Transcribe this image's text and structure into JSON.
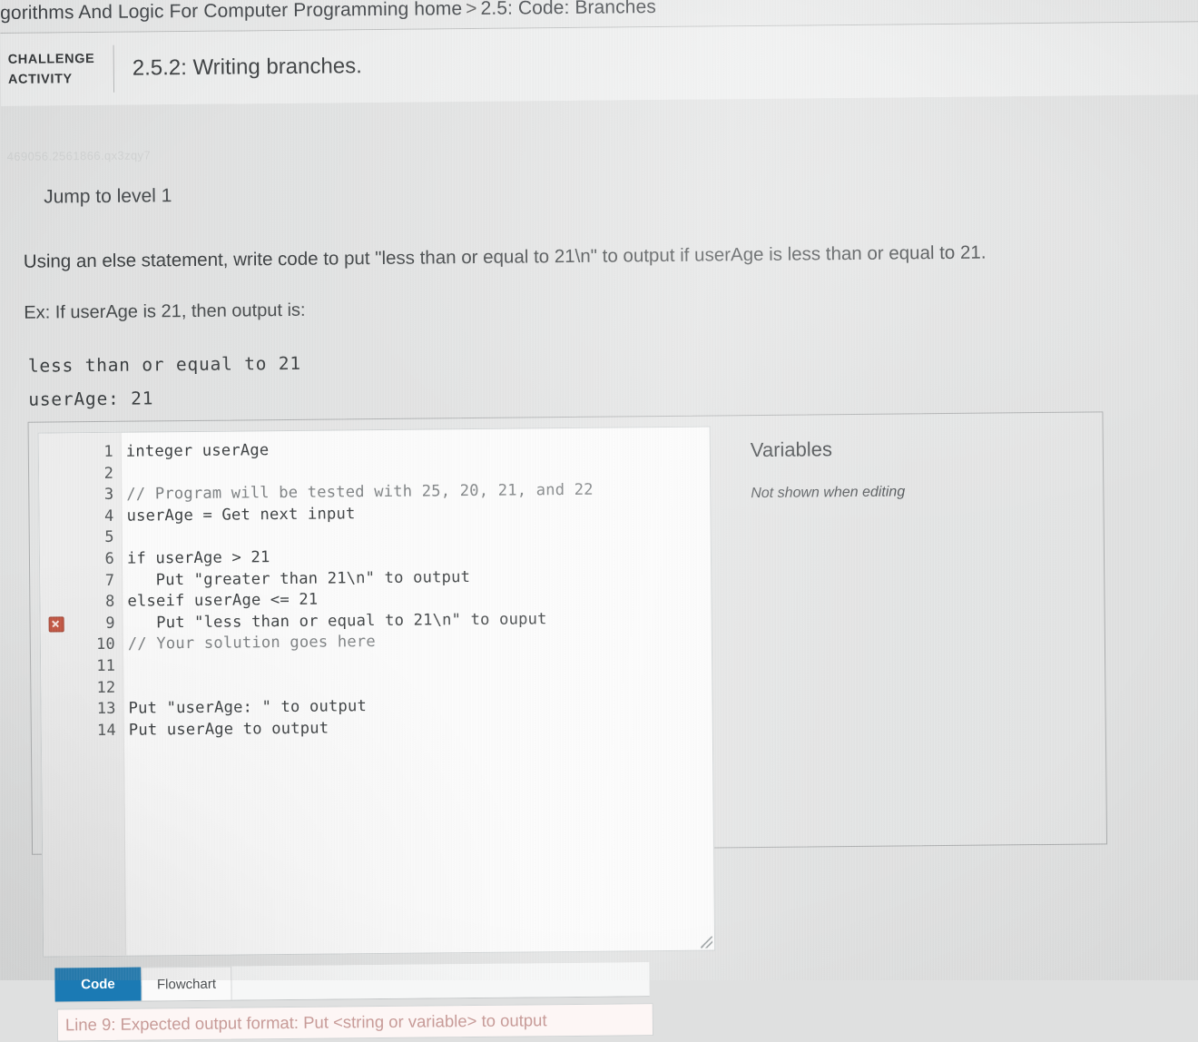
{
  "header": {
    "breadcrumb_course": "gorithms And Logic For Computer Programming home",
    "breadcrumb_separator": ">",
    "breadcrumb_section": "2.5: Code: Branches",
    "window_icon": "window-restore-icon",
    "challenge_tag_line1": "CHALLENGE",
    "challenge_tag_line2": "ACTIVITY",
    "challenge_title": "2.5.2: Writing branches."
  },
  "activity": {
    "activity_id": "469056.2561866.qx3zqy7",
    "level_label": "Jump to level 1",
    "prompt_main": "Using an else statement, write code to put \"less than or equal to 21\\n\" to output if userAge is less than or equal to 21.",
    "prompt_example": "Ex: If userAge is 21, then output is:",
    "example_output": "less than or equal to 21\nuserAge: 21"
  },
  "editor": {
    "lines": [
      {
        "num": "1",
        "text": "integer userAge",
        "error": false,
        "comment": false
      },
      {
        "num": "2",
        "text": "",
        "error": false,
        "comment": false
      },
      {
        "num": "3",
        "text": "// Program will be tested with 25, 20, 21, and 22",
        "error": false,
        "comment": true
      },
      {
        "num": "4",
        "text": "userAge = Get next input",
        "error": false,
        "comment": false
      },
      {
        "num": "5",
        "text": "",
        "error": false,
        "comment": false
      },
      {
        "num": "6",
        "text": "if userAge > 21",
        "error": false,
        "comment": false
      },
      {
        "num": "7",
        "text": "   Put \"greater than 21\\n\" to output",
        "error": false,
        "comment": false
      },
      {
        "num": "8",
        "text": "elseif userAge <= 21",
        "error": false,
        "comment": false
      },
      {
        "num": "9",
        "text": "   Put \"less than or equal to 21\\n\" to ouput",
        "error": true,
        "comment": false
      },
      {
        "num": "10",
        "text": "// Your solution goes here",
        "error": false,
        "comment": true
      },
      {
        "num": "11",
        "text": "",
        "error": false,
        "comment": false
      },
      {
        "num": "12",
        "text": "",
        "error": false,
        "comment": false
      },
      {
        "num": "13",
        "text": "Put \"userAge: \" to output",
        "error": false,
        "comment": false
      },
      {
        "num": "14",
        "text": "Put userAge to output",
        "error": false,
        "comment": false
      }
    ],
    "error_marker_icon": "error-x-icon",
    "resize_handle_icon": "resize-grip-icon"
  },
  "variables": {
    "title": "Variables",
    "note": "Not shown when editing"
  },
  "tabs": [
    {
      "label": "Code",
      "active": true
    },
    {
      "label": "Flowchart",
      "active": false
    }
  ],
  "status": {
    "error_message": "Line 9: Expected output format: Put <string or variable> to output"
  },
  "colors": {
    "page_background": "#dfe0e0",
    "active_tab": "#1b7ab4",
    "error_marker": "#c0503c",
    "error_text": "#c79b98",
    "editor_background": "#fbfbfb",
    "gutter_background": "#ececec"
  }
}
